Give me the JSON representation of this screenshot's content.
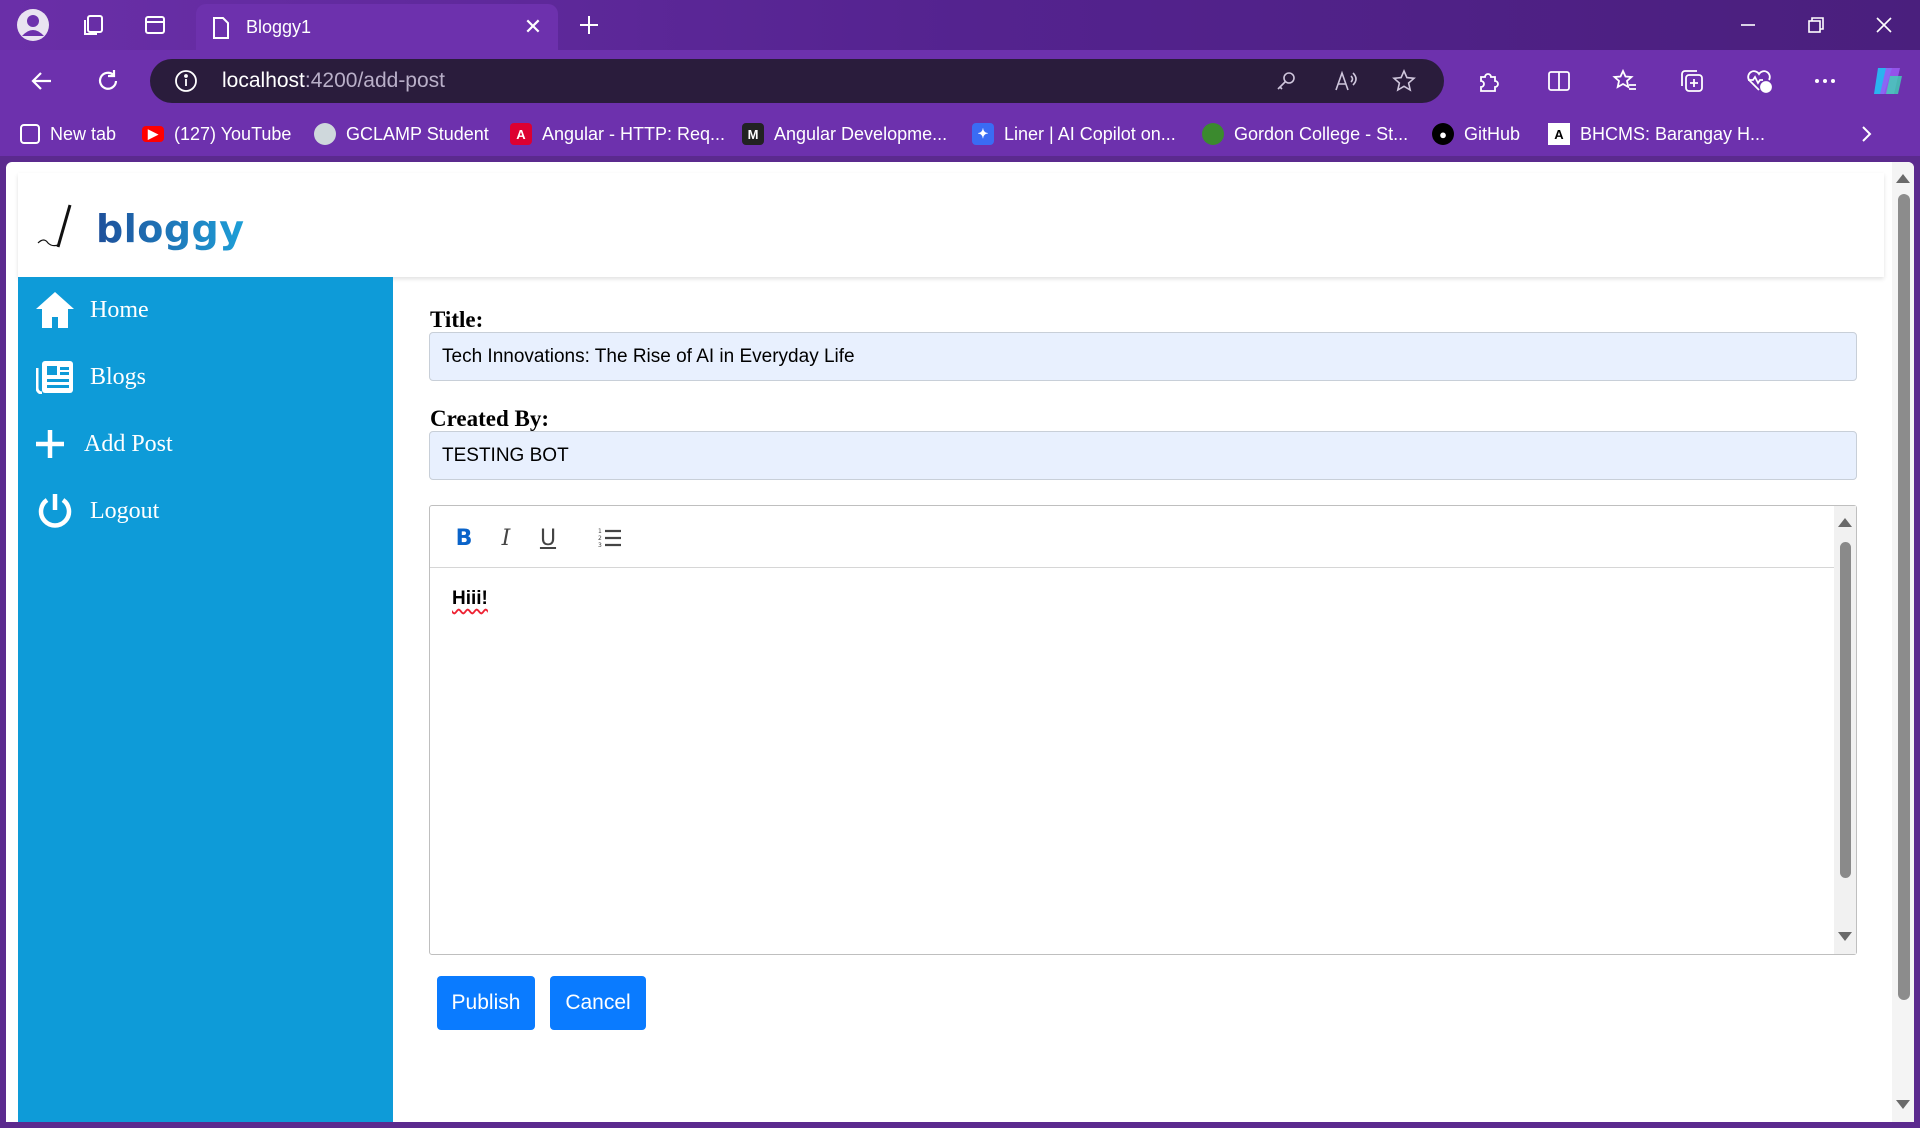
{
  "browser": {
    "tab_title": "Bloggy1",
    "url_host": "localhost",
    "url_rest": ":4200/add-post",
    "bookmarks": [
      {
        "label": "New tab",
        "icon": "new-tab-icon",
        "color": "#ffffff"
      },
      {
        "label": "(127) YouTube",
        "icon": "youtube-icon",
        "color": "#ff0000"
      },
      {
        "label": "GCLAMP Student",
        "icon": "gclamp-icon",
        "color": "#cfd8dc"
      },
      {
        "label": "Angular - HTTP: Req...",
        "icon": "angular-icon",
        "color": "#dd0031"
      },
      {
        "label": "Angular Developme...",
        "icon": "angular-dev-icon",
        "color": "#222222"
      },
      {
        "label": "Liner | AI Copilot on...",
        "icon": "liner-icon",
        "color": "#3a6cf4"
      },
      {
        "label": "Gordon College - St...",
        "icon": "gordon-college-icon",
        "color": "#3b8a2e"
      },
      {
        "label": "GitHub",
        "icon": "github-icon",
        "color": "#000000"
      },
      {
        "label": "BHCMS: Barangay H...",
        "icon": "bhcms-icon",
        "color": "#ffffff"
      }
    ]
  },
  "app": {
    "logo_text": "bloggy",
    "brand_color": "#0e9bd8",
    "sidebar": {
      "items": [
        {
          "label": "Home",
          "icon": "home-icon"
        },
        {
          "label": "Blogs",
          "icon": "newspaper-icon"
        },
        {
          "label": "Add Post",
          "icon": "plus-icon"
        },
        {
          "label": "Logout",
          "icon": "power-icon"
        }
      ]
    },
    "form": {
      "title_label": "Title:",
      "title_value": "Tech Innovations: The Rise of AI in Everyday Life",
      "created_by_label": "Created By:",
      "created_by_value": "TESTING BOT",
      "editor": {
        "tools": [
          {
            "label": "B",
            "name": "bold"
          },
          {
            "label": "I",
            "name": "italic"
          },
          {
            "label": "U",
            "name": "underline"
          },
          {
            "label": "list",
            "name": "ordered-list"
          }
        ],
        "content": "Hiii!"
      },
      "publish_label": "Publish",
      "cancel_label": "Cancel",
      "button_color": "#0a7bff"
    }
  }
}
